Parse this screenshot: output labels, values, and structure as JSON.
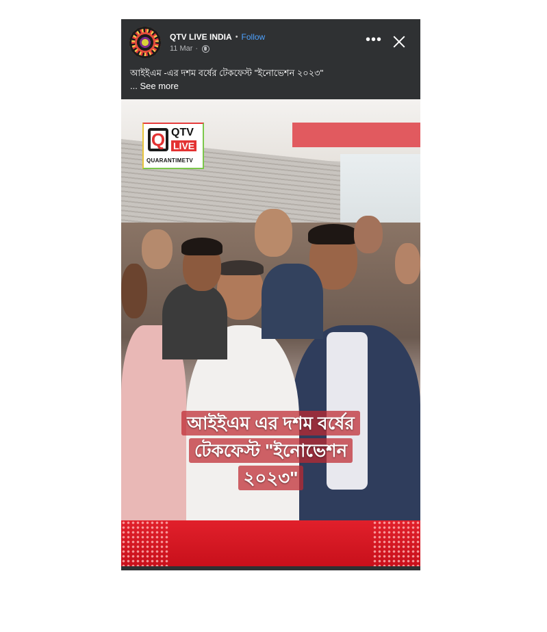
{
  "post": {
    "page_name": "QTV LIVE INDIA",
    "separator": "•",
    "follow_label": "Follow",
    "date": "11 Mar",
    "meta_separator": "·",
    "caption": "আইইএম -এর দশম বর্ষের টেকফেস্ট \"ইনোভেশন ২০২৩\"",
    "see_more": "... See more",
    "more_icon": "more-horizontal-icon",
    "close_icon": "close-icon",
    "privacy_icon": "globe-icon"
  },
  "media": {
    "logo": {
      "q": "Q",
      "qtv": "QTV",
      "live": "LIVE",
      "sub": "QUARANTIMETV"
    },
    "subtitle_lines": [
      "আইইএম এর দশম বর্ষের",
      "টেকফেস্ট \"ইনোভেশন",
      "২০২৩\""
    ]
  },
  "colors": {
    "header_bg": "#2f3133",
    "follow": "#4ea2ff",
    "brand_red": "#e1202b"
  }
}
